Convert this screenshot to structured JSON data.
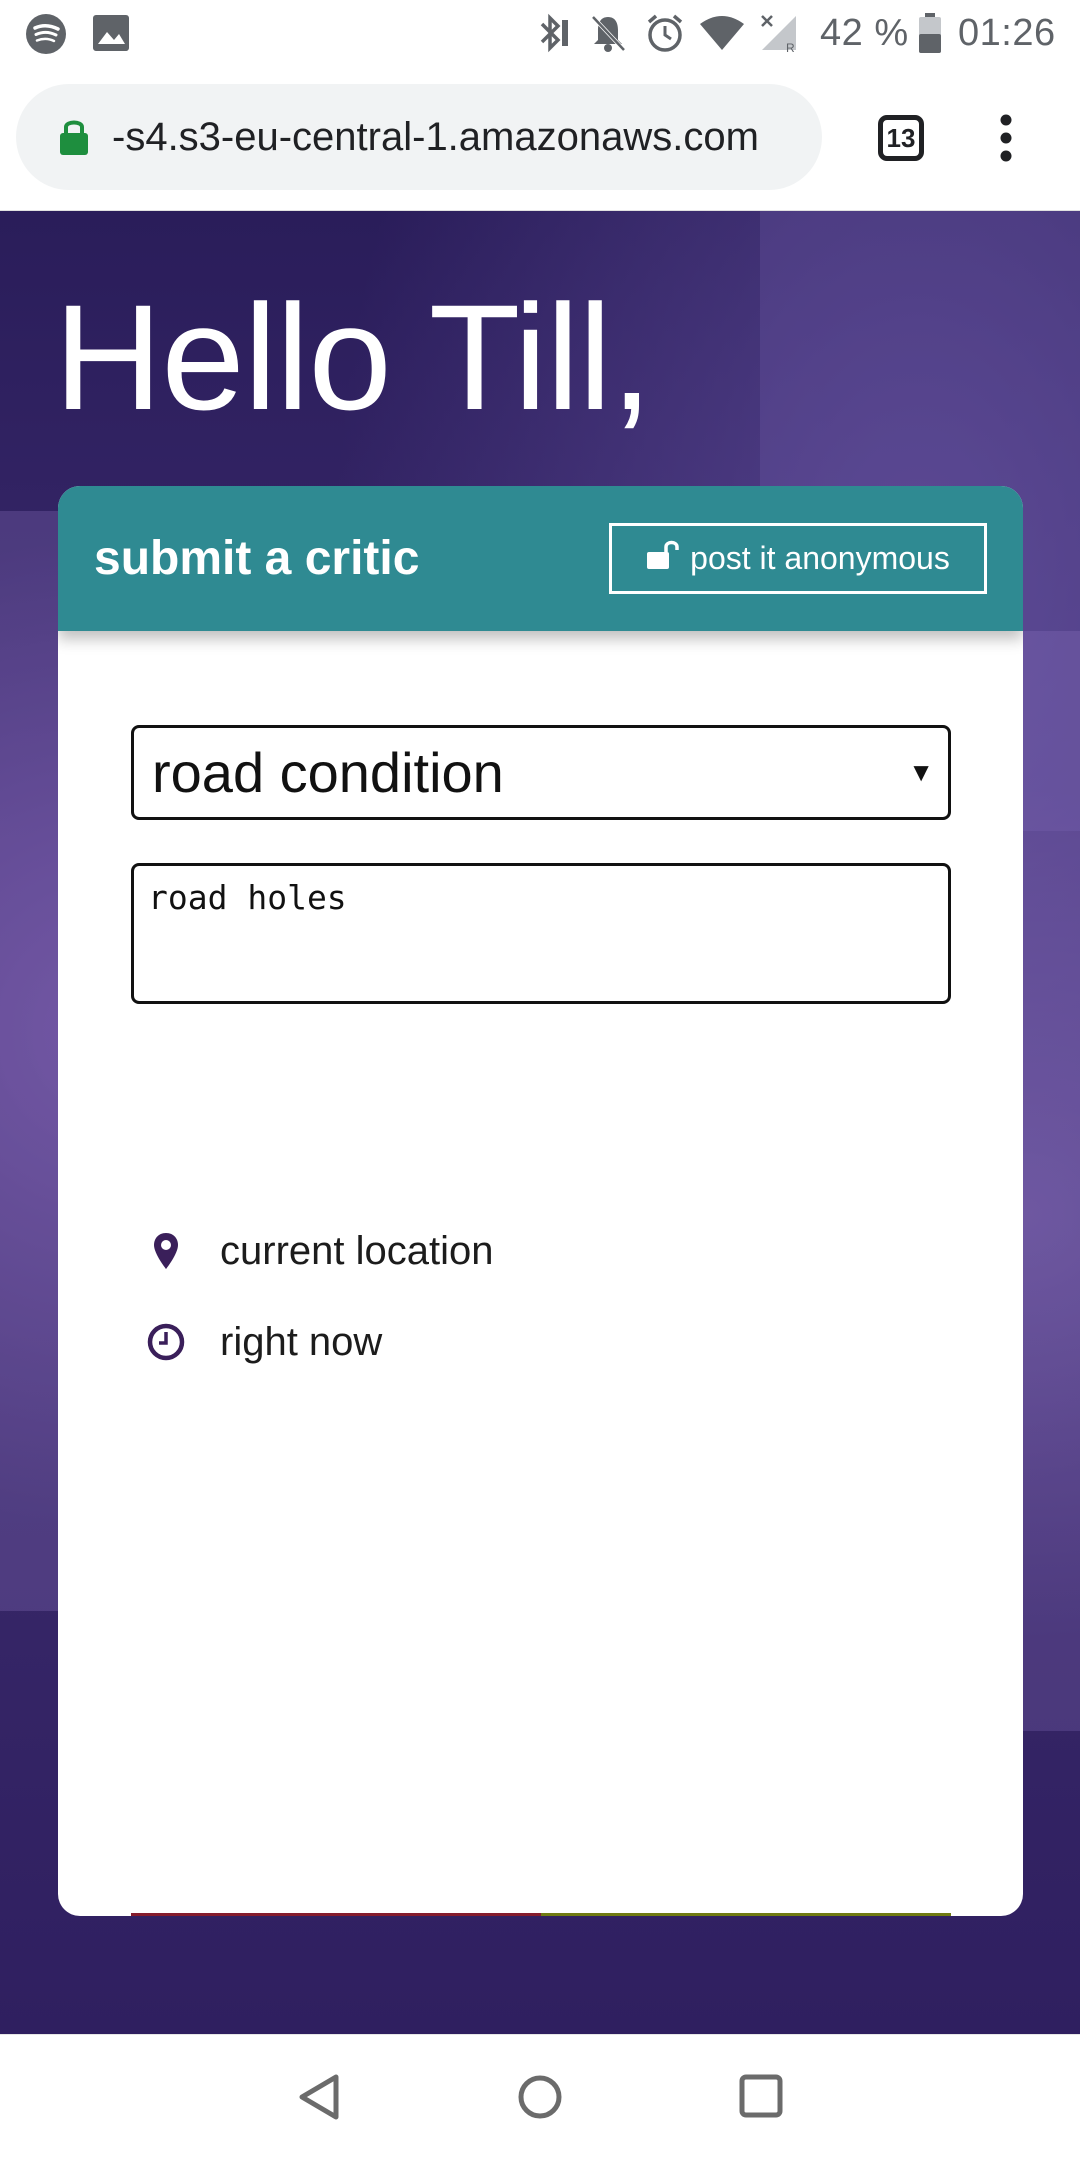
{
  "status_bar": {
    "battery": "42 %",
    "time": "01:26",
    "left_icons": [
      "spotify-icon",
      "image-icon"
    ],
    "right_icons": [
      "bluetooth-icon",
      "notifications-off-icon",
      "alarm-icon",
      "wifi-icon",
      "signal-icon",
      "battery-icon"
    ]
  },
  "browser": {
    "url": "-s4.s3-eu-central-1.amazonaws.com",
    "tab_count": "13",
    "lock_color": "#1e8e3e"
  },
  "page": {
    "greeting": "Hello Till,"
  },
  "card": {
    "title": "submit a critic",
    "anonymous_label": "post it anonymous",
    "category": {
      "selected": "road condition"
    },
    "description": "road holes",
    "location_label": "current location",
    "time_label": "right now",
    "vote": {
      "down_icon": "thumbs-down-icon",
      "up_icon": "thumbs-up-icon"
    }
  },
  "colors": {
    "header_teal": "#2f8a92",
    "vote_down": "#851c2d",
    "vote_up": "#707b12",
    "background_purple": "#3b2a6e",
    "icon_purple": "#3a1f5a"
  }
}
